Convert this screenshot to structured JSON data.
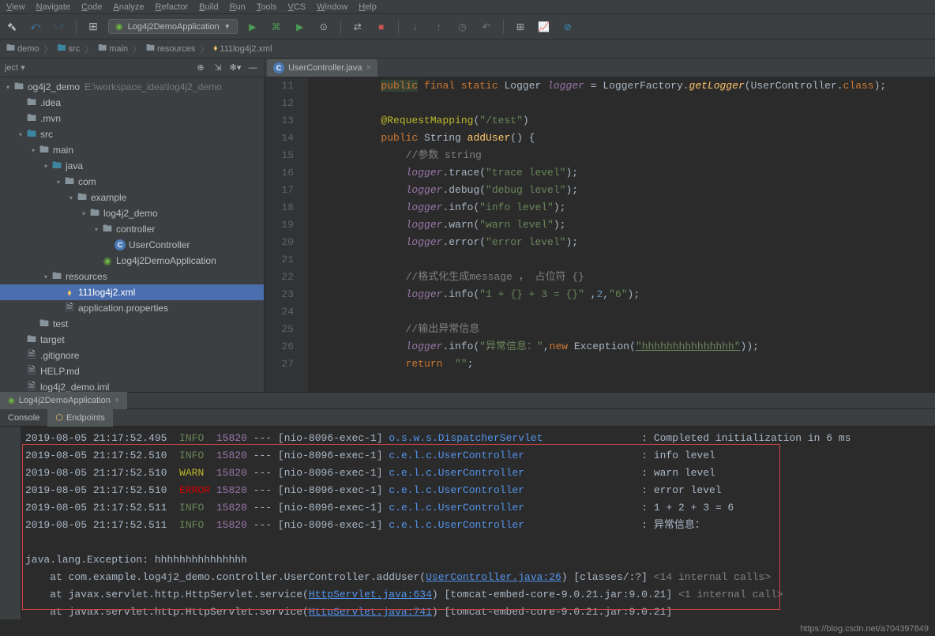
{
  "menu": [
    "View",
    "Navigate",
    "Code",
    "Analyze",
    "Refactor",
    "Build",
    "Run",
    "Tools",
    "VCS",
    "Window",
    "Help"
  ],
  "runConfig": "Log4j2DemoApplication",
  "breadcrumb": [
    {
      "t": "demo",
      "i": "folder"
    },
    {
      "t": "src",
      "i": "folder-src"
    },
    {
      "t": "main",
      "i": "folder"
    },
    {
      "t": "resources",
      "i": "folder"
    },
    {
      "t": "111log4j2.xml",
      "i": "xml"
    }
  ],
  "sidebarHeader": "ject ▾",
  "tree": [
    {
      "d": 0,
      "a": "▾",
      "i": "folder",
      "l": "og4j2_demo",
      "dim": "E:\\workspace_idea\\log4j2_demo"
    },
    {
      "d": 1,
      "a": "",
      "i": "folder",
      "l": ".idea"
    },
    {
      "d": 1,
      "a": "",
      "i": "folder",
      "l": ".mvn"
    },
    {
      "d": 1,
      "a": "▾",
      "i": "folder-src",
      "l": "src"
    },
    {
      "d": 2,
      "a": "▾",
      "i": "folder",
      "l": "main"
    },
    {
      "d": 3,
      "a": "▾",
      "i": "folder-src",
      "l": "java"
    },
    {
      "d": 4,
      "a": "▾",
      "i": "folder",
      "l": "com"
    },
    {
      "d": 5,
      "a": "▾",
      "i": "folder",
      "l": "example"
    },
    {
      "d": 6,
      "a": "▾",
      "i": "folder",
      "l": "log4j2_demo"
    },
    {
      "d": 7,
      "a": "▾",
      "i": "folder",
      "l": "controller"
    },
    {
      "d": 8,
      "a": "",
      "i": "class",
      "l": "UserController"
    },
    {
      "d": 7,
      "a": "",
      "i": "spring",
      "l": "Log4j2DemoApplication"
    },
    {
      "d": 3,
      "a": "▾",
      "i": "folder",
      "l": "resources"
    },
    {
      "d": 4,
      "a": "",
      "i": "xml",
      "l": "111log4j2.xml",
      "sel": true
    },
    {
      "d": 4,
      "a": "",
      "i": "file",
      "l": "application.properties"
    },
    {
      "d": 2,
      "a": "",
      "i": "folder",
      "l": "test"
    },
    {
      "d": 1,
      "a": "",
      "i": "folder",
      "l": "target"
    },
    {
      "d": 1,
      "a": "",
      "i": "file",
      "l": ".gitignore"
    },
    {
      "d": 1,
      "a": "",
      "i": "file",
      "l": "HELP.md"
    },
    {
      "d": 1,
      "a": "",
      "i": "file",
      "l": "log4j2_demo.iml"
    }
  ],
  "editorTab": {
    "name": "UserController.java",
    "icon": "class"
  },
  "code": [
    {
      "n": 11,
      "html": "        <span class='kw-hl'>public</span> <span class='kw'>final static</span> <span class='cls'>Logger</span> <span class='it'>logger</span> = LoggerFactory.<span class='it-fn'>getLogger</span>(UserController.<span class='kw'>class</span>);"
    },
    {
      "n": 12,
      "html": ""
    },
    {
      "n": 13,
      "html": "        <span class='ann'>@RequestMapping</span>(<span class='str'>\"/test\"</span>)"
    },
    {
      "n": 14,
      "html": "        <span class='kw'>public</span> String <span class='fn'>addUser</span>() {"
    },
    {
      "n": 15,
      "html": "            <span class='cmt'>//参数 string</span>"
    },
    {
      "n": 16,
      "html": "            <span class='it'>logger</span>.trace(<span class='str'>\"trace level\"</span>);"
    },
    {
      "n": 17,
      "html": "            <span class='it'>logger</span>.debug(<span class='str'>\"debug level\"</span>);"
    },
    {
      "n": 18,
      "html": "            <span class='it'>logger</span>.info(<span class='str'>\"info level\"</span>);"
    },
    {
      "n": 19,
      "html": "            <span class='it'>logger</span>.warn(<span class='str'>\"warn level\"</span>);"
    },
    {
      "n": 20,
      "html": "            <span class='it'>logger</span>.error(<span class='str'>\"error level\"</span>);"
    },
    {
      "n": 21,
      "html": ""
    },
    {
      "n": 22,
      "html": "            <span class='cmt'>//格式化生成message ， 占位符 {}</span>"
    },
    {
      "n": 23,
      "html": "            <span class='it'>logger</span>.info(<span class='str'>\"1 + {} + 3 = {}\"</span> ,<span class='num-lit'>2</span>,<span class='str'>\"6\"</span>);"
    },
    {
      "n": 24,
      "html": ""
    },
    {
      "n": 25,
      "html": "            <span class='cmt'>//输出异常信息</span>"
    },
    {
      "n": 26,
      "html": "            <span class='it'>logger</span>.info(<span class='str'>\"异常信息：\"</span>,<span class='kw'>new</span> Exception(<span class='link-u'>\"hhhhhhhhhhhhhhh\"</span>));"
    },
    {
      "n": 27,
      "html": "            <span class='kw'>return</span>  <span class='str'>\"\"</span>;"
    }
  ],
  "bottomTab1": "Log4j2DemoApplication",
  "bottomTabs2": [
    "Console",
    "Endpoints"
  ],
  "logs": [
    {
      "t": "2019-08-05 21:17:52.495",
      "lv": "INFO",
      "lvc": "lg-info",
      "pid": "15820",
      "th": "[nio-8096-exec-1]",
      "lg": "o.s.w.s.DispatcherServlet",
      "msg": "Completed initialization in 6 ms"
    },
    {
      "t": "2019-08-05 21:17:52.510",
      "lv": "INFO",
      "lvc": "lg-info",
      "pid": "15820",
      "th": "[nio-8096-exec-1]",
      "lg": "c.e.l.c.UserController",
      "msg": "info level"
    },
    {
      "t": "2019-08-05 21:17:52.510",
      "lv": "WARN",
      "lvc": "lg-warn",
      "pid": "15820",
      "th": "[nio-8096-exec-1]",
      "lg": "c.e.l.c.UserController",
      "msg": "warn level"
    },
    {
      "t": "2019-08-05 21:17:52.510",
      "lv": "ERROR",
      "lvc": "lg-error",
      "pid": "15820",
      "th": "[nio-8096-exec-1]",
      "lg": "c.e.l.c.UserController",
      "msg": "error level"
    },
    {
      "t": "2019-08-05 21:17:52.511",
      "lv": "INFO",
      "lvc": "lg-info",
      "pid": "15820",
      "th": "[nio-8096-exec-1]",
      "lg": "c.e.l.c.UserController",
      "msg": "1 + 2 + 3 = 6"
    },
    {
      "t": "2019-08-05 21:17:52.511",
      "lv": "INFO",
      "lvc": "lg-info",
      "pid": "15820",
      "th": "[nio-8096-exec-1]",
      "lg": "c.e.l.c.UserController",
      "msg": "异常信息："
    }
  ],
  "stack": {
    "head": "java.lang.Exception: hhhhhhhhhhhhhhh",
    "lines": [
      {
        "p": "    at com.example.log4j2_demo.controller.UserController.addUser(",
        "link": "UserController.java:26",
        "s": ") [classes/:?]",
        "note": "<14 internal calls>"
      },
      {
        "p": "    at javax.servlet.http.HttpServlet.service(",
        "link": "HttpServlet.java:634",
        "s": ") [tomcat-embed-core-9.0.21.jar:9.0.21]",
        "note": "<1 internal call>"
      },
      {
        "p": "    at javax.servlet.http.HttpServlet.service(",
        "link": "HttpServlet.java:741",
        "s": ") [tomcat-embed-core-9.0.21.jar:9.0.21]",
        "note": ""
      }
    ]
  },
  "statusUrl": "https://blog.csdn.net/a704397849"
}
